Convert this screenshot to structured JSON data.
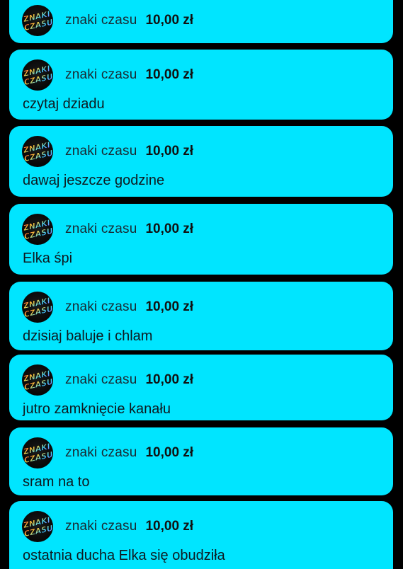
{
  "colors": {
    "card_background": "#00e5ff",
    "page_background": "#000000",
    "name_text": "#1a2a33",
    "amount_text": "#111111"
  },
  "avatar": {
    "icon": "znaki-czasu-logo-icon",
    "logo_text_line1": "ZNAKI",
    "logo_text_line2": "CZASU"
  },
  "donations": [
    {
      "name": "znaki czasu",
      "amount": "10,00 zł",
      "message": ""
    },
    {
      "name": "znaki czasu",
      "amount": "10,00 zł",
      "message": "czytaj dziadu"
    },
    {
      "name": "znaki czasu",
      "amount": "10,00 zł",
      "message": "dawaj jeszcze godzine"
    },
    {
      "name": "znaki czasu",
      "amount": "10,00 zł",
      "message": "Elka śpi"
    },
    {
      "name": "znaki czasu",
      "amount": "10,00 zł",
      "message": "dzisiaj baluje i chlam"
    },
    {
      "name": "znaki czasu",
      "amount": "10,00 zł",
      "message": "jutro zamknięcie kanału"
    },
    {
      "name": "znaki czasu",
      "amount": "10,00 zł",
      "message": "sram na to"
    },
    {
      "name": "znaki czasu",
      "amount": "10,00 zł",
      "message": "ostatnia ducha Elka się obudziła"
    }
  ]
}
